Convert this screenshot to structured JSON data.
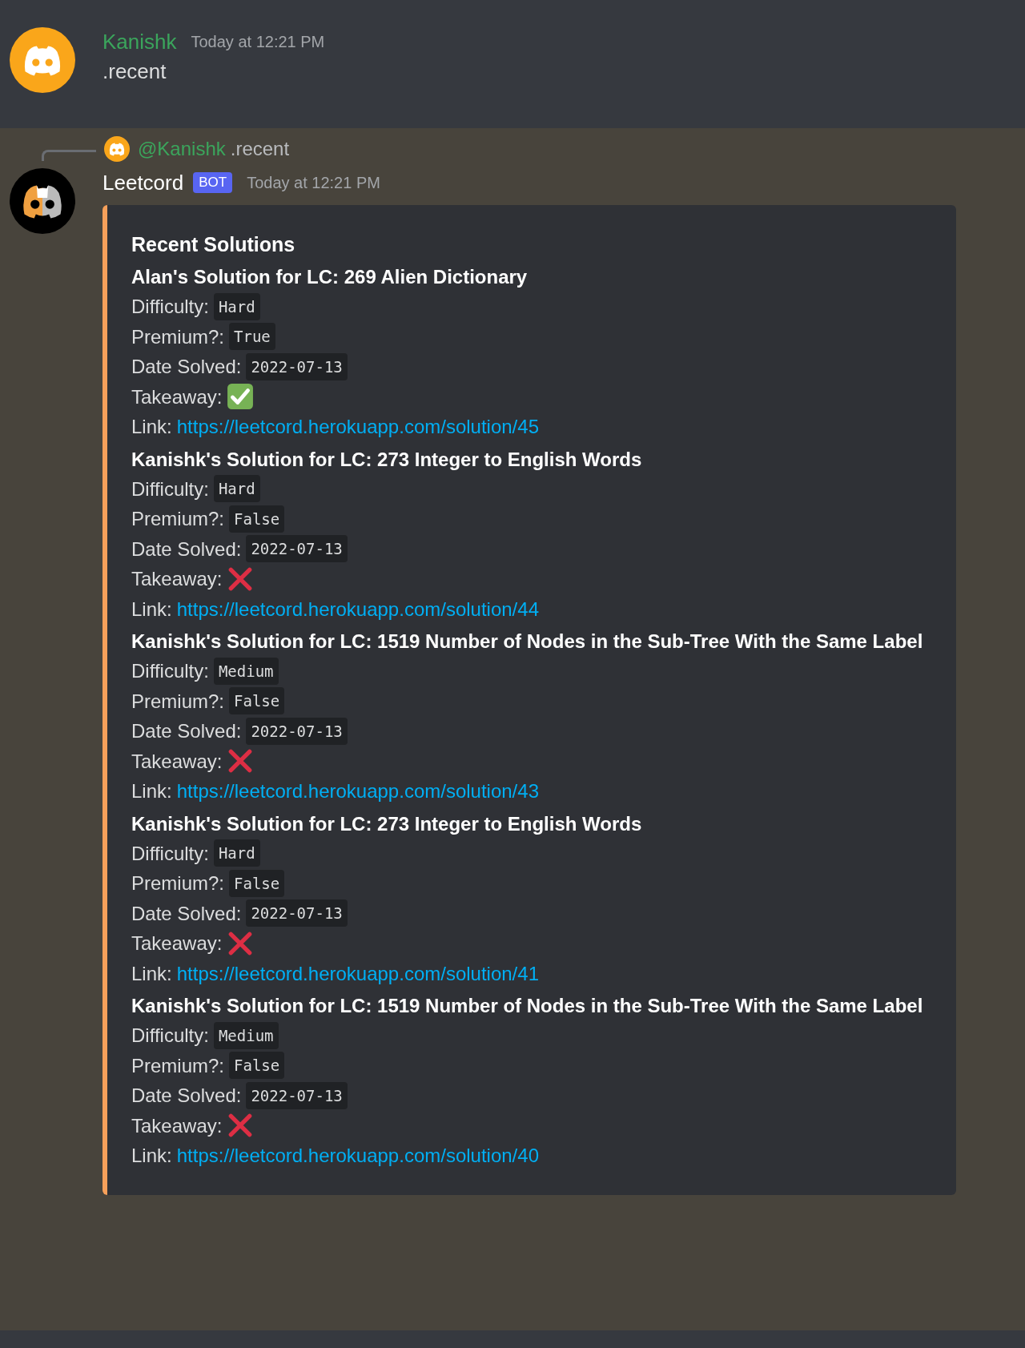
{
  "user_message": {
    "author": "Kanishk",
    "timestamp": "Today at 12:21 PM",
    "text": ".recent"
  },
  "bot_message": {
    "reply": {
      "mention": "@Kanishk",
      "text": ".recent"
    },
    "author": "Leetcord",
    "badge": "BOT",
    "timestamp": "Today at 12:21 PM",
    "embed": {
      "title": "Recent Solutions",
      "solutions": [
        {
          "title": "Alan's Solution for LC: 269 Alien Dictionary",
          "fields": [
            {
              "label": "Difficulty:",
              "value": "Hard"
            },
            {
              "label": "Premium?:",
              "value": "True"
            },
            {
              "label": "Date Solved:",
              "value": "2022-07-13"
            }
          ],
          "takeaway": {
            "label": "Takeaway:",
            "ok": true
          },
          "link": {
            "label": "Link:",
            "url": "https://leetcord.herokuapp.com/solution/45"
          }
        },
        {
          "title": "Kanishk's Solution for LC: 273 Integer to English Words",
          "fields": [
            {
              "label": "Difficulty:",
              "value": "Hard"
            },
            {
              "label": "Premium?:",
              "value": "False"
            },
            {
              "label": "Date Solved:",
              "value": "2022-07-13"
            }
          ],
          "takeaway": {
            "label": "Takeaway:",
            "ok": false
          },
          "link": {
            "label": "Link:",
            "url": "https://leetcord.herokuapp.com/solution/44"
          }
        },
        {
          "title": "Kanishk's Solution for LC: 1519 Number of Nodes in the Sub-Tree With the Same Label",
          "fields": [
            {
              "label": "Difficulty:",
              "value": "Medium"
            },
            {
              "label": "Premium?:",
              "value": "False"
            },
            {
              "label": "Date Solved:",
              "value": "2022-07-13"
            }
          ],
          "takeaway": {
            "label": "Takeaway:",
            "ok": false
          },
          "link": {
            "label": "Link:",
            "url": "https://leetcord.herokuapp.com/solution/43"
          }
        },
        {
          "title": "Kanishk's Solution for LC: 273 Integer to English Words",
          "fields": [
            {
              "label": "Difficulty:",
              "value": "Hard"
            },
            {
              "label": "Premium?:",
              "value": "False"
            },
            {
              "label": "Date Solved:",
              "value": "2022-07-13"
            }
          ],
          "takeaway": {
            "label": "Takeaway:",
            "ok": false
          },
          "link": {
            "label": "Link:",
            "url": "https://leetcord.herokuapp.com/solution/41"
          }
        },
        {
          "title": "Kanishk's Solution for LC: 1519 Number of Nodes in the Sub-Tree With the Same Label",
          "fields": [
            {
              "label": "Difficulty:",
              "value": "Medium"
            },
            {
              "label": "Premium?:",
              "value": "False"
            },
            {
              "label": "Date Solved:",
              "value": "2022-07-13"
            }
          ],
          "takeaway": {
            "label": "Takeaway:",
            "ok": false
          },
          "link": {
            "label": "Link:",
            "url": "https://leetcord.herokuapp.com/solution/40"
          }
        }
      ]
    }
  }
}
